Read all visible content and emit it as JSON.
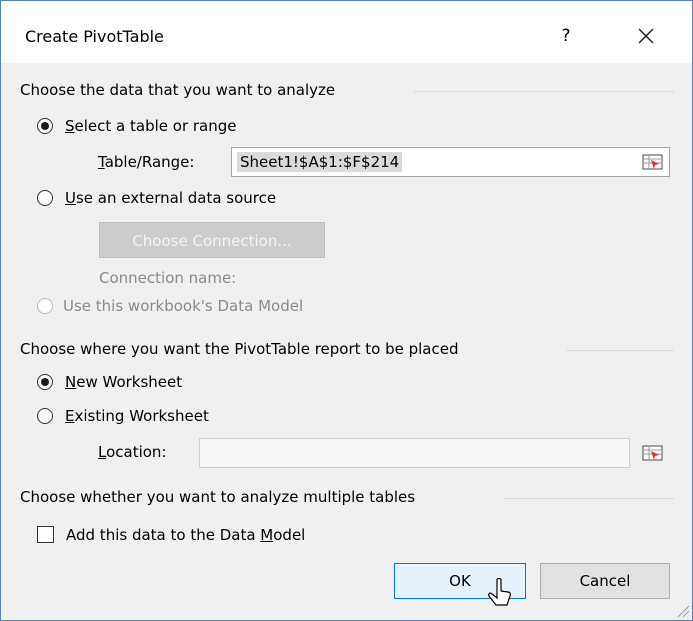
{
  "dialog": {
    "title": "Create PivotTable",
    "help_label": "?",
    "close_label": "Close"
  },
  "data_section": {
    "heading": "Choose the data that you want to analyze",
    "select_range": {
      "accel": "S",
      "rest": "elect a table or range",
      "checked": true
    },
    "table_range": {
      "accel": "T",
      "rest": "able/Range:",
      "value": "Sheet1!$A$1:$F$214"
    },
    "external": {
      "accel": "U",
      "rest": "se an external data source",
      "checked": false
    },
    "choose_connection_label": "Choose Connection...",
    "connection_name_label": "Connection name:",
    "data_model_option": {
      "label": "Use this workbook's Data Model",
      "checked": false,
      "disabled": true
    }
  },
  "placement_section": {
    "heading": "Choose where you want the PivotTable report to be placed",
    "new_worksheet": {
      "accel": "N",
      "rest": "ew Worksheet",
      "checked": true
    },
    "existing_worksheet": {
      "accel": "E",
      "rest": "xisting Worksheet",
      "checked": false
    },
    "location": {
      "accel": "L",
      "rest": "ocation:",
      "value": ""
    }
  },
  "multiple_tables_section": {
    "heading": "Choose whether you want to analyze multiple tables",
    "add_to_model": {
      "before": "Add this data to the Data ",
      "accel": "M",
      "after": "odel",
      "checked": false
    }
  },
  "footer": {
    "ok_label": "OK",
    "cancel_label": "Cancel"
  },
  "icons": {
    "range_picker": "range-picker-icon",
    "close": "close-icon",
    "cursor": "mouse-pointer-icon",
    "resize": "resize-grip-icon"
  },
  "colors": {
    "ok_border": "#0078d7",
    "dialog_bg": "#f0f0f0",
    "title_bg": "#ffffff",
    "disabled_text": "#8a8a8a"
  }
}
